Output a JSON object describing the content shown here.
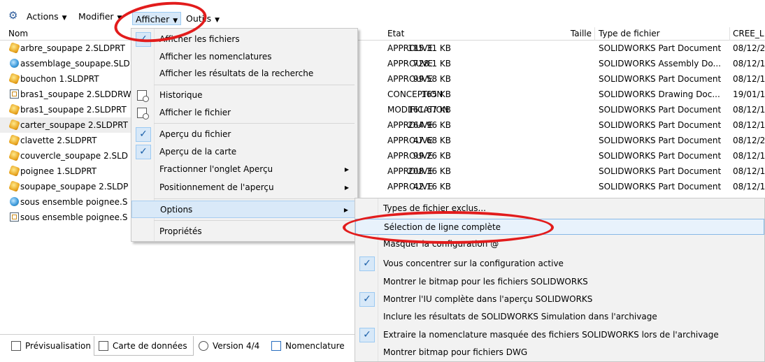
{
  "toolbar": {
    "actions_label": "Actions",
    "modifier_label": "Modifier",
    "afficher_label": "Afficher",
    "outils_label": "Outils"
  },
  "columns": {
    "nom": "Nom",
    "etat": "Etat",
    "taille": "Taille",
    "type": "Type de fichier",
    "cree": "CREE_L"
  },
  "files": [
    {
      "name": "arbre_soupape 2.SLDPRT",
      "kind": "part"
    },
    {
      "name": "assemblage_soupape.SLD",
      "kind": "assembly"
    },
    {
      "name": "bouchon 1.SLDPRT",
      "kind": "part"
    },
    {
      "name": "bras1_soupape 2.SLDDRW",
      "kind": "drawing"
    },
    {
      "name": "bras1_soupape 2.SLDPRT",
      "kind": "part"
    },
    {
      "name": "carter_soupape 2.SLDPRT",
      "kind": "part"
    },
    {
      "name": "clavette 2.SLDPRT",
      "kind": "part"
    },
    {
      "name": "couvercle_soupape 2.SLD",
      "kind": "part"
    },
    {
      "name": "poignee 1.SLDPRT",
      "kind": "part"
    },
    {
      "name": "soupape_soupape 2.SLDP",
      "kind": "part"
    },
    {
      "name": "sous ensemble poignee.S",
      "kind": "assembly"
    },
    {
      "name": "sous ensemble poignee.S",
      "kind": "drawing"
    }
  ],
  "details": [
    {
      "etat": "APPROUVE",
      "taille": "115.31 KB",
      "type": "SOLIDWORKS Part Document",
      "date": "08/12/2"
    },
    {
      "etat": "APPROUVE",
      "taille": "728.1 KB",
      "type": "SOLIDWORKS Assembly Do...",
      "date": "08/12/1"
    },
    {
      "etat": "APPROUVE",
      "taille": "99.58 KB",
      "type": "SOLIDWORKS Part Document",
      "date": "08/12/1"
    },
    {
      "etat": "CONCEPTION",
      "taille": "165 KB",
      "type": "SOLIDWORKS Drawing Doc...",
      "date": "19/01/1"
    },
    {
      "etat": "MODIFICATION",
      "taille": "161.67 KB",
      "type": "SOLIDWORKS Part Document",
      "date": "08/12/1"
    },
    {
      "etat": "APPROUVE",
      "taille": "264.96 KB",
      "type": "SOLIDWORKS Part Document",
      "date": "08/12/1"
    },
    {
      "etat": "APPROUVE",
      "taille": "47.68 KB",
      "type": "SOLIDWORKS Part Document",
      "date": "08/12/2"
    },
    {
      "etat": "APPROUVE",
      "taille": "99.26 KB",
      "type": "SOLIDWORKS Part Document",
      "date": "08/12/1"
    },
    {
      "etat": "APPROUVE",
      "taille": "208.36 KB",
      "type": "SOLIDWORKS Part Document",
      "date": "08/12/1"
    },
    {
      "etat": "APPROUVE",
      "taille": "42.16 KB",
      "type": "SOLIDWORKS Part Document",
      "date": "08/12/1"
    }
  ],
  "afficher_menu": [
    {
      "label": "Afficher les fichiers",
      "checked": true
    },
    {
      "label": "Afficher les nomenclatures",
      "checked": false
    },
    {
      "label": "Afficher les résultats de la recherche",
      "checked": false
    },
    {
      "label": "Historique",
      "icon": "history-icon"
    },
    {
      "label": "Afficher le fichier",
      "icon": "view-file-icon"
    },
    {
      "label": "Aperçu du fichier",
      "checked": true
    },
    {
      "label": "Aperçu de la carte",
      "checked": true
    },
    {
      "label": "Fractionner l'onglet Aperçu",
      "submenu": true
    },
    {
      "label": "Positionnement de l'aperçu",
      "submenu": true
    },
    {
      "label": "Options",
      "submenu": true,
      "highlighted": true
    },
    {
      "label": "Propriétés"
    }
  ],
  "options_menu": [
    {
      "label": "Types de fichier exclus...",
      "checked": false
    },
    {
      "label": "Sélection de ligne complète",
      "checked": false,
      "hover": true
    },
    {
      "label": "Masquer la configuration @",
      "checked": false
    },
    {
      "label": "Vous concentrer sur la configuration active",
      "checked": true
    },
    {
      "label": "Montrer le bitmap pour les fichiers SOLIDWORKS",
      "checked": false
    },
    {
      "label": "Montrer l'IU complète dans l'aperçu SOLIDWORKS",
      "checked": true
    },
    {
      "label": "Inclure les résultats de SOLIDWORKS Simulation dans l'archivage",
      "checked": false
    },
    {
      "label": "Extraire la nomenclature masquée des fichiers SOLIDWORKS lors de l'archivage",
      "checked": true
    },
    {
      "label": "Montrer bitmap pour fichiers DWG",
      "checked": false
    }
  ],
  "tabs": [
    {
      "label": "Prévisualisation",
      "icon": "preview-icon"
    },
    {
      "label": "Carte de données",
      "icon": "datacard-icon",
      "selected": true
    },
    {
      "label": "Version 4/4",
      "icon": "version-icon"
    },
    {
      "label": "Nomenclature",
      "icon": "bom-icon"
    }
  ],
  "colors": {
    "accent": "#1a5fa8",
    "highlight": "#d9e9f8",
    "annotation": "#e21c1c"
  }
}
